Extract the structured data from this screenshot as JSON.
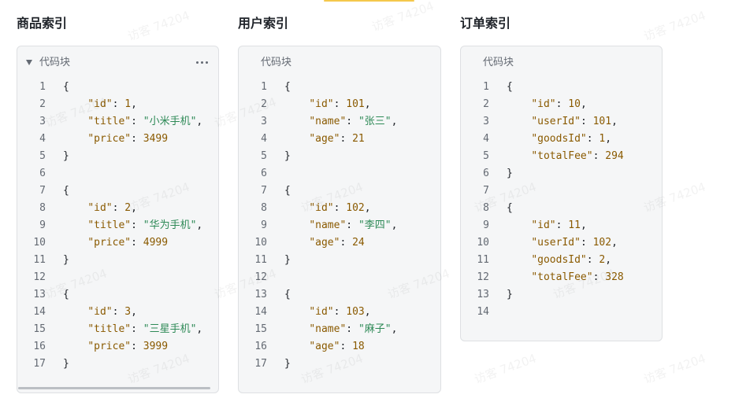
{
  "watermark": "访客 74204",
  "sections": [
    {
      "title": "商品索引",
      "header": "代码块",
      "lines": [
        [
          {
            "t": "p",
            "v": "{"
          }
        ],
        [
          {
            "t": "p",
            "v": "    "
          },
          {
            "t": "k",
            "v": "\"id\""
          },
          {
            "t": "p",
            "v": ": "
          },
          {
            "t": "n",
            "v": "1"
          },
          {
            "t": "p",
            "v": ","
          }
        ],
        [
          {
            "t": "p",
            "v": "    "
          },
          {
            "t": "k",
            "v": "\"title\""
          },
          {
            "t": "p",
            "v": ": "
          },
          {
            "t": "s",
            "v": "\"小米手机\""
          },
          {
            "t": "p",
            "v": ","
          }
        ],
        [
          {
            "t": "p",
            "v": "    "
          },
          {
            "t": "k",
            "v": "\"price\""
          },
          {
            "t": "p",
            "v": ": "
          },
          {
            "t": "n",
            "v": "3499"
          }
        ],
        [
          {
            "t": "p",
            "v": "}"
          }
        ],
        [],
        [
          {
            "t": "p",
            "v": "{"
          }
        ],
        [
          {
            "t": "p",
            "v": "    "
          },
          {
            "t": "k",
            "v": "\"id\""
          },
          {
            "t": "p",
            "v": ": "
          },
          {
            "t": "n",
            "v": "2"
          },
          {
            "t": "p",
            "v": ","
          }
        ],
        [
          {
            "t": "p",
            "v": "    "
          },
          {
            "t": "k",
            "v": "\"title\""
          },
          {
            "t": "p",
            "v": ": "
          },
          {
            "t": "s",
            "v": "\"华为手机\""
          },
          {
            "t": "p",
            "v": ","
          }
        ],
        [
          {
            "t": "p",
            "v": "    "
          },
          {
            "t": "k",
            "v": "\"price\""
          },
          {
            "t": "p",
            "v": ": "
          },
          {
            "t": "n",
            "v": "4999"
          }
        ],
        [
          {
            "t": "p",
            "v": "}"
          }
        ],
        [],
        [
          {
            "t": "p",
            "v": "{"
          }
        ],
        [
          {
            "t": "p",
            "v": "    "
          },
          {
            "t": "k",
            "v": "\"id\""
          },
          {
            "t": "p",
            "v": ": "
          },
          {
            "t": "n",
            "v": "3"
          },
          {
            "t": "p",
            "v": ","
          }
        ],
        [
          {
            "t": "p",
            "v": "    "
          },
          {
            "t": "k",
            "v": "\"title\""
          },
          {
            "t": "p",
            "v": ": "
          },
          {
            "t": "s",
            "v": "\"三星手机\""
          },
          {
            "t": "p",
            "v": ","
          }
        ],
        [
          {
            "t": "p",
            "v": "    "
          },
          {
            "t": "k",
            "v": "\"price\""
          },
          {
            "t": "p",
            "v": ": "
          },
          {
            "t": "n",
            "v": "3999"
          }
        ],
        [
          {
            "t": "p",
            "v": "}"
          }
        ]
      ]
    },
    {
      "title": "用户索引",
      "header": "代码块",
      "lines": [
        [
          {
            "t": "p",
            "v": "{"
          }
        ],
        [
          {
            "t": "p",
            "v": "    "
          },
          {
            "t": "k",
            "v": "\"id\""
          },
          {
            "t": "p",
            "v": ": "
          },
          {
            "t": "n",
            "v": "101"
          },
          {
            "t": "p",
            "v": ","
          }
        ],
        [
          {
            "t": "p",
            "v": "    "
          },
          {
            "t": "k",
            "v": "\"name\""
          },
          {
            "t": "p",
            "v": ": "
          },
          {
            "t": "s",
            "v": "\"张三\""
          },
          {
            "t": "p",
            "v": ","
          }
        ],
        [
          {
            "t": "p",
            "v": "    "
          },
          {
            "t": "k",
            "v": "\"age\""
          },
          {
            "t": "p",
            "v": ": "
          },
          {
            "t": "n",
            "v": "21"
          }
        ],
        [
          {
            "t": "p",
            "v": "}"
          }
        ],
        [],
        [
          {
            "t": "p",
            "v": "{"
          }
        ],
        [
          {
            "t": "p",
            "v": "    "
          },
          {
            "t": "k",
            "v": "\"id\""
          },
          {
            "t": "p",
            "v": ": "
          },
          {
            "t": "n",
            "v": "102"
          },
          {
            "t": "p",
            "v": ","
          }
        ],
        [
          {
            "t": "p",
            "v": "    "
          },
          {
            "t": "k",
            "v": "\"name\""
          },
          {
            "t": "p",
            "v": ": "
          },
          {
            "t": "s",
            "v": "\"李四\""
          },
          {
            "t": "p",
            "v": ","
          }
        ],
        [
          {
            "t": "p",
            "v": "    "
          },
          {
            "t": "k",
            "v": "\"age\""
          },
          {
            "t": "p",
            "v": ": "
          },
          {
            "t": "n",
            "v": "24"
          }
        ],
        [
          {
            "t": "p",
            "v": "}"
          }
        ],
        [],
        [
          {
            "t": "p",
            "v": "{"
          }
        ],
        [
          {
            "t": "p",
            "v": "    "
          },
          {
            "t": "k",
            "v": "\"id\""
          },
          {
            "t": "p",
            "v": ": "
          },
          {
            "t": "n",
            "v": "103"
          },
          {
            "t": "p",
            "v": ","
          }
        ],
        [
          {
            "t": "p",
            "v": "    "
          },
          {
            "t": "k",
            "v": "\"name\""
          },
          {
            "t": "p",
            "v": ": "
          },
          {
            "t": "s",
            "v": "\"麻子\""
          },
          {
            "t": "p",
            "v": ","
          }
        ],
        [
          {
            "t": "p",
            "v": "    "
          },
          {
            "t": "k",
            "v": "\"age\""
          },
          {
            "t": "p",
            "v": ": "
          },
          {
            "t": "n",
            "v": "18"
          }
        ],
        [
          {
            "t": "p",
            "v": "}"
          }
        ]
      ]
    },
    {
      "title": "订单索引",
      "header": "代码块",
      "lines": [
        [
          {
            "t": "p",
            "v": "{"
          }
        ],
        [
          {
            "t": "p",
            "v": "    "
          },
          {
            "t": "k",
            "v": "\"id\""
          },
          {
            "t": "p",
            "v": ": "
          },
          {
            "t": "n",
            "v": "10"
          },
          {
            "t": "p",
            "v": ","
          }
        ],
        [
          {
            "t": "p",
            "v": "    "
          },
          {
            "t": "k",
            "v": "\"userId\""
          },
          {
            "t": "p",
            "v": ": "
          },
          {
            "t": "n",
            "v": "101"
          },
          {
            "t": "p",
            "v": ","
          }
        ],
        [
          {
            "t": "p",
            "v": "    "
          },
          {
            "t": "k",
            "v": "\"goodsId\""
          },
          {
            "t": "p",
            "v": ": "
          },
          {
            "t": "n",
            "v": "1"
          },
          {
            "t": "p",
            "v": ","
          }
        ],
        [
          {
            "t": "p",
            "v": "    "
          },
          {
            "t": "k",
            "v": "\"totalFee\""
          },
          {
            "t": "p",
            "v": ": "
          },
          {
            "t": "n",
            "v": "294"
          }
        ],
        [
          {
            "t": "p",
            "v": "}"
          }
        ],
        [],
        [
          {
            "t": "p",
            "v": "{"
          }
        ],
        [
          {
            "t": "p",
            "v": "    "
          },
          {
            "t": "k",
            "v": "\"id\""
          },
          {
            "t": "p",
            "v": ": "
          },
          {
            "t": "n",
            "v": "11"
          },
          {
            "t": "p",
            "v": ","
          }
        ],
        [
          {
            "t": "p",
            "v": "    "
          },
          {
            "t": "k",
            "v": "\"userId\""
          },
          {
            "t": "p",
            "v": ": "
          },
          {
            "t": "n",
            "v": "102"
          },
          {
            "t": "p",
            "v": ","
          }
        ],
        [
          {
            "t": "p",
            "v": "    "
          },
          {
            "t": "k",
            "v": "\"goodsId\""
          },
          {
            "t": "p",
            "v": ": "
          },
          {
            "t": "n",
            "v": "2"
          },
          {
            "t": "p",
            "v": ","
          }
        ],
        [
          {
            "t": "p",
            "v": "    "
          },
          {
            "t": "k",
            "v": "\"totalFee\""
          },
          {
            "t": "p",
            "v": ": "
          },
          {
            "t": "n",
            "v": "328"
          }
        ],
        [
          {
            "t": "p",
            "v": "}"
          }
        ],
        []
      ]
    }
  ]
}
